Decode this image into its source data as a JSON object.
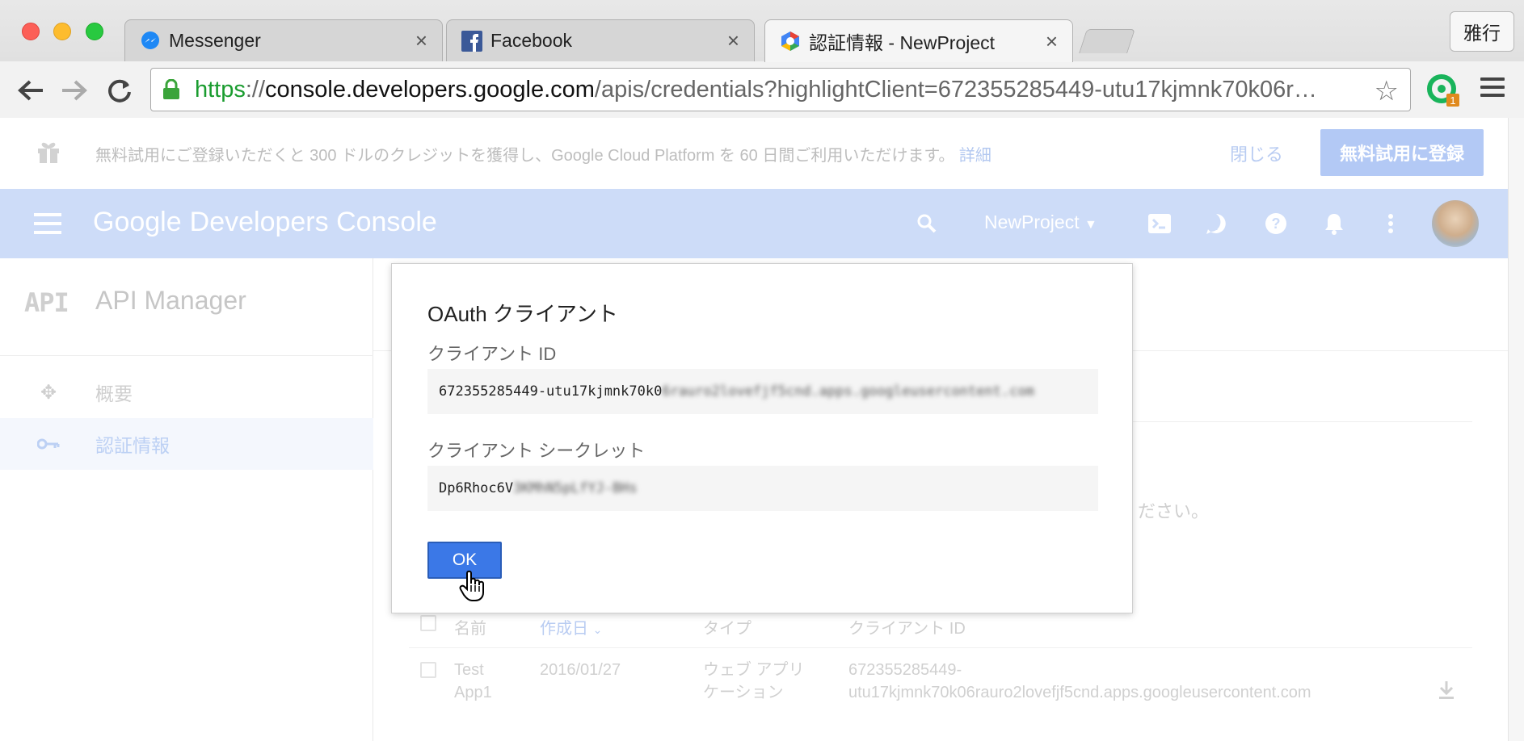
{
  "browser": {
    "tabs": [
      {
        "label": "Messenger",
        "icon": "messenger-icon"
      },
      {
        "label": "Facebook",
        "icon": "facebook-icon"
      },
      {
        "label": "認証情報 - NewProject",
        "icon": "google-cloud-icon"
      }
    ],
    "profile_button": "雅行",
    "url": {
      "scheme": "https",
      "separator": "://",
      "host": "console.developers.google.com",
      "path": "/apis/credentials?highlightClient=672355285449-utu17kjmnk70k06r…"
    }
  },
  "promo": {
    "text": "無料試用にご登録いただくと 300 ドルのクレジットを獲得し、Google Cloud Platform を 60 日間ご利用いただけます。",
    "link": "詳細",
    "close": "閉じる",
    "signup": "無料試用に登録"
  },
  "appbar": {
    "brand_google": "Google",
    "brand_rest": "Developers Console",
    "project": "NewProject"
  },
  "sidebar": {
    "logo": "API",
    "title": "API Manager",
    "items": [
      {
        "label": "概要",
        "active": false
      },
      {
        "label": "認証情報",
        "active": true
      }
    ]
  },
  "background": {
    "hint_fragment": "ください。"
  },
  "table": {
    "headers": {
      "name": "名前",
      "created": "作成日",
      "type": "タイプ",
      "client_id": "クライアント ID"
    },
    "rows": [
      {
        "name_line1": "Test",
        "name_line2": "App1",
        "created": "2016/01/27",
        "type_line1": "ウェブ アプリ",
        "type_line2": "ケーション",
        "client_id_line1": "672355285449-",
        "client_id_line2": "utu17kjmnk70k06rauro2lovefjf5cnd.apps.googleusercontent.com"
      }
    ]
  },
  "modal": {
    "title": "OAuth クライアント",
    "client_id_label": "クライアント ID",
    "client_id_visible": "672355285449-utu17kjmnk70k0",
    "client_id_blurred": "6rauro2lovefjf5cnd.apps.googleusercontent.com",
    "secret_label": "クライアント シークレット",
    "secret_visible": "Dp6Rhoc6V",
    "secret_blurred": "3KMhN5pLfYJ-BHs",
    "ok_label": "OK"
  }
}
